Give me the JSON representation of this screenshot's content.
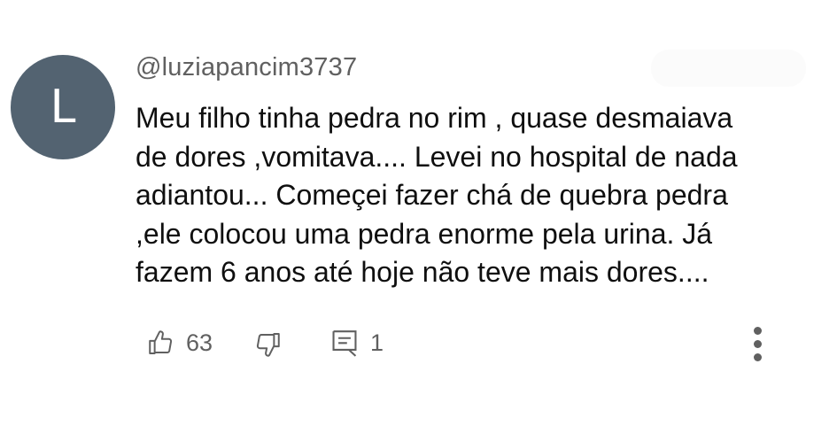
{
  "comment": {
    "avatar_letter": "L",
    "avatar_color": "#536371",
    "author": "@luziapancim3737",
    "text_lines": [
      "Meu filho tinha pedra no rim , quase desmaiava",
      "de dores ,vomitava.... Levei no hospital de nada",
      "adiantou... Começei fazer chá de quebra pedra",
      ",ele colocou uma pedra enorme pela urina. Já",
      "fazem 6 anos até hoje não teve mais dores...."
    ],
    "likes": "63",
    "replies": "1"
  },
  "icons": {
    "like": "thumbs-up-icon",
    "dislike": "thumbs-down-icon",
    "reply": "reply-comment-icon",
    "more": "more-vertical-icon"
  },
  "colors": {
    "text": "#0f0f0f",
    "secondary": "#606060",
    "background": "#ffffff"
  }
}
